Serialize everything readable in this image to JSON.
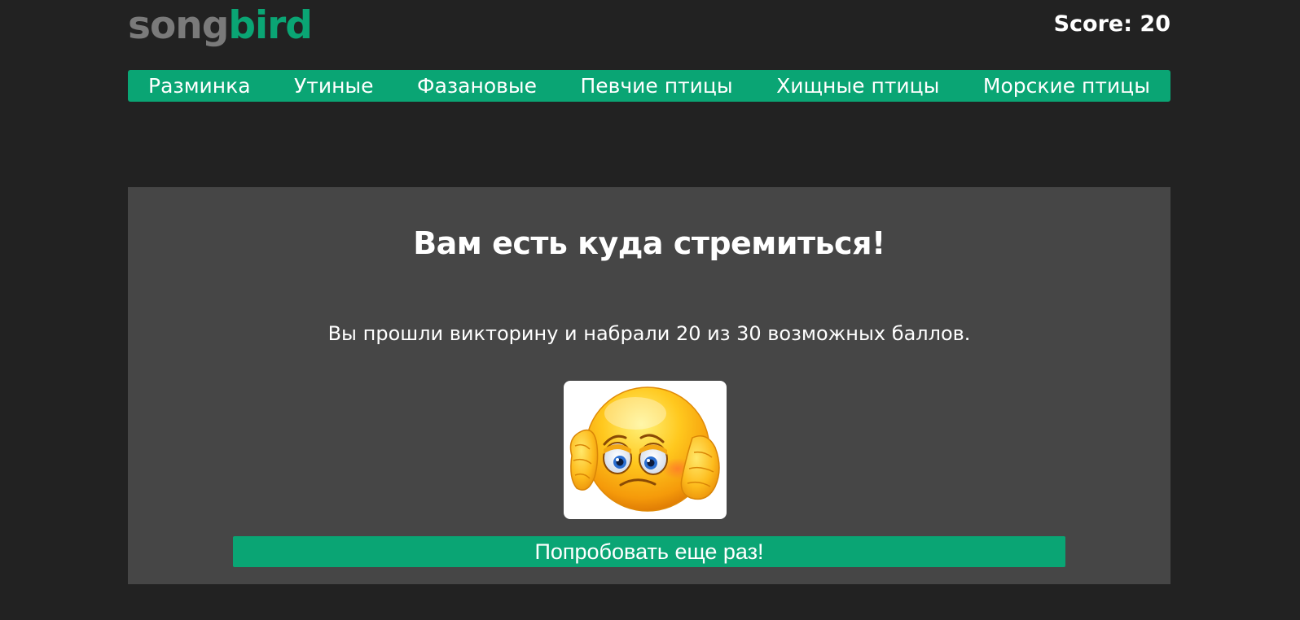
{
  "logo": {
    "part1": "song",
    "part2": "bird"
  },
  "score": {
    "label": "Score: 20"
  },
  "nav": {
    "items": [
      {
        "label": "Разминка"
      },
      {
        "label": "Утиные"
      },
      {
        "label": "Фазановые"
      },
      {
        "label": "Певчие птицы"
      },
      {
        "label": "Хищные птицы"
      },
      {
        "label": "Морские птицы"
      }
    ]
  },
  "result": {
    "title": "Вам есть куда стремиться!",
    "message": "Вы прошли викторину и набрали 20 из 30 возможных баллов.",
    "image_icon": "sad-face-emoji-icon",
    "retry_label": "Попробовать еще раз!"
  },
  "colors": {
    "background": "#222222",
    "panel": "#464646",
    "accent": "#0aa574",
    "logo_gray": "#7a7a7a",
    "text": "#ffffff"
  }
}
